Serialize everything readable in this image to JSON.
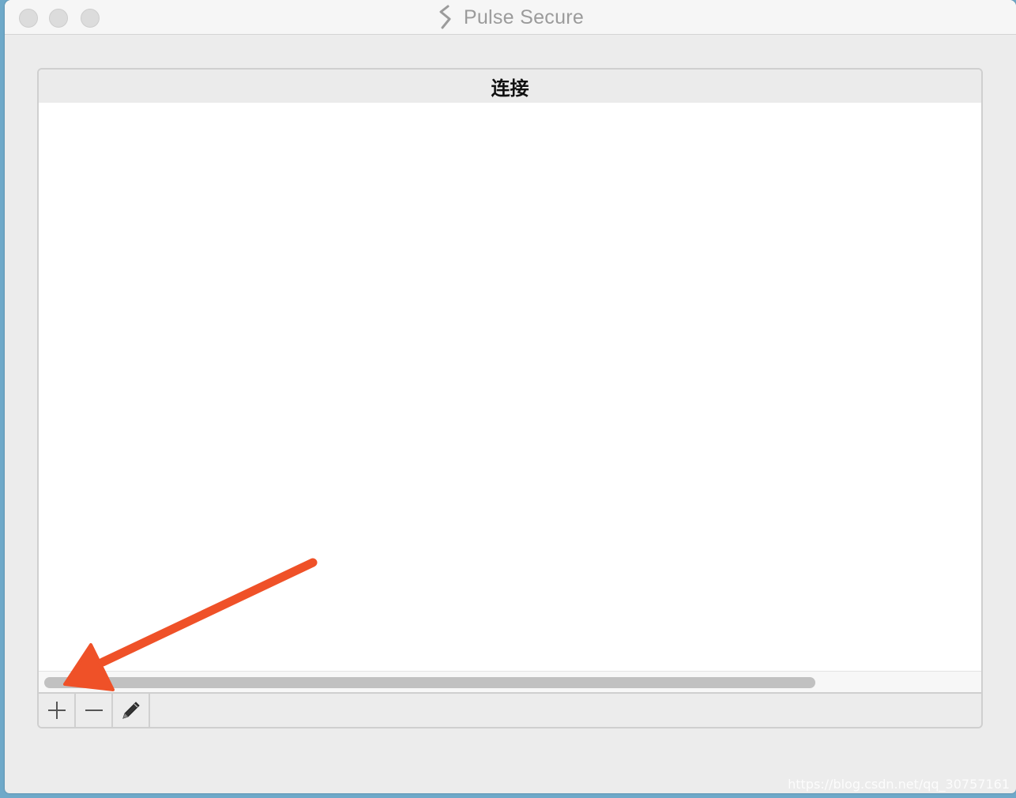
{
  "window": {
    "title": "Pulse Secure",
    "app_icon": "pulse-secure-logo-icon"
  },
  "panel": {
    "header": "连接",
    "items": []
  },
  "toolbar": {
    "add_icon": "plus-icon",
    "remove_icon": "minus-icon",
    "edit_icon": "pencil-icon"
  },
  "annotation": {
    "arrow_color": "#ef5128",
    "target": "add-connection-button"
  },
  "watermark": "https://blog.csdn.net/qq_30757161"
}
